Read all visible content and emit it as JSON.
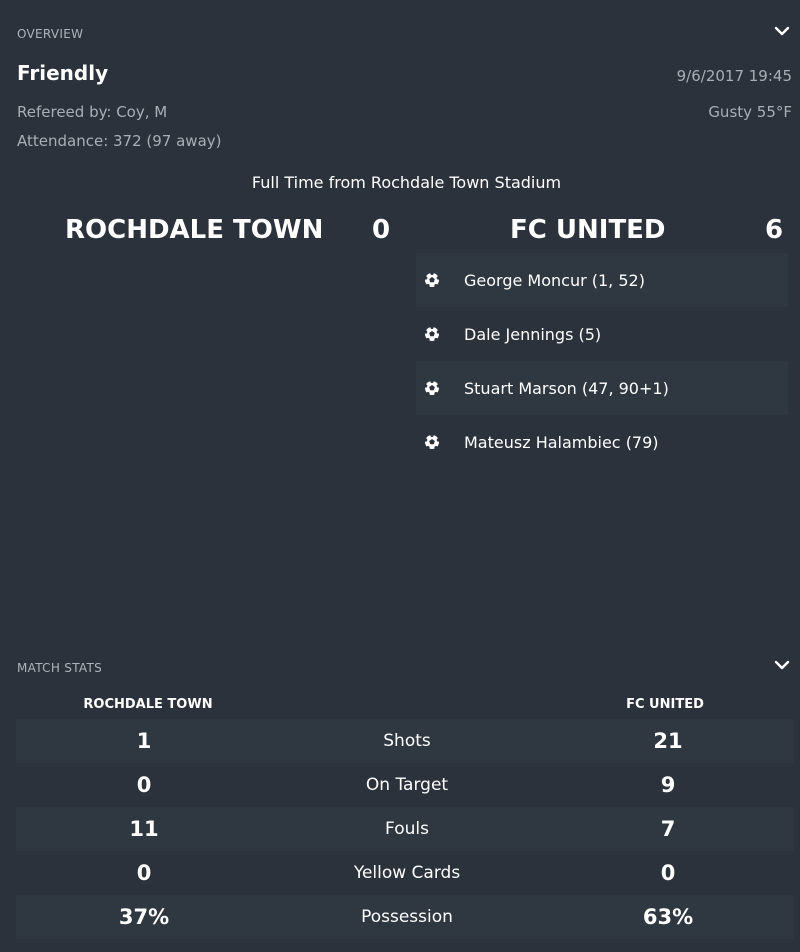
{
  "overview": {
    "section_title": "OVERVIEW",
    "competition": "Friendly",
    "referee": "Refereed by: Coy, M",
    "attendance": "Attendance: 372 (97 away)",
    "datetime": "9/6/2017 19:45",
    "weather": "Gusty 55°F",
    "status": "Full Time from Rochdale Town Stadium"
  },
  "match": {
    "home_team": "ROCHDALE TOWN",
    "home_score": "0",
    "away_team": "FC UNITED",
    "away_score": "6",
    "away_scorers": [
      {
        "text": "George Moncur (1, 52)",
        "icon": "football-icon"
      },
      {
        "text": "Dale Jennings (5)",
        "icon": "football-icon"
      },
      {
        "text": "Stuart Marson (47, 90+1)",
        "icon": "football-icon"
      },
      {
        "text": "Mateusz Halambiec (79)",
        "icon": "football-icon"
      }
    ]
  },
  "match_stats": {
    "section_title": "MATCH STATS",
    "home_header": "ROCHDALE TOWN",
    "away_header": "FC UNITED",
    "rows": [
      {
        "label": "Shots",
        "home": "1",
        "away": "21"
      },
      {
        "label": "On Target",
        "home": "0",
        "away": "9"
      },
      {
        "label": "Fouls",
        "home": "11",
        "away": "7"
      },
      {
        "label": "Yellow Cards",
        "home": "0",
        "away": "0"
      },
      {
        "label": "Possession",
        "home": "37%",
        "away": "63%"
      }
    ]
  },
  "colors": {
    "background": "#2b323b",
    "row_shade": "#2f3741",
    "muted_text": "#a9afb6"
  }
}
